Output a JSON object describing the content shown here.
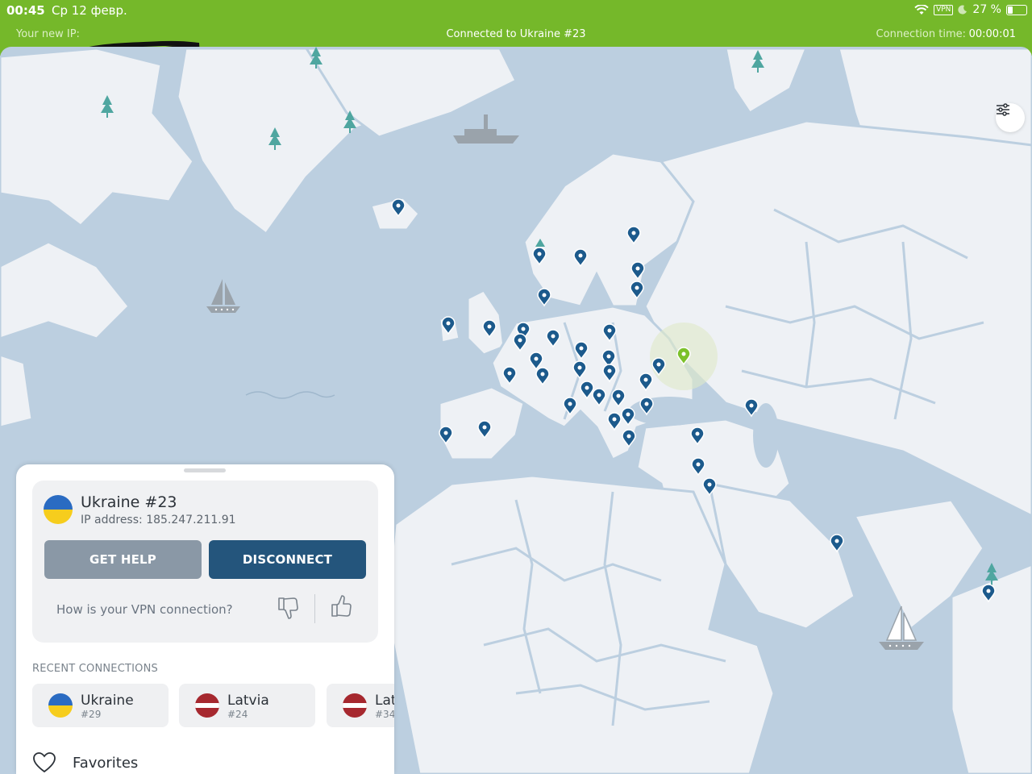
{
  "status_bar": {
    "time": "00:45",
    "date": "Ср 12 февр.",
    "vpn_badge": "VPN",
    "battery": "27 %",
    "battery_level": 0.27
  },
  "connection_bar": {
    "ip_label": "Your new IP:",
    "status": "Connected to Ukraine #23",
    "time_label": "Connection time:",
    "time": "00:00:01"
  },
  "map": {
    "active_marker_color": "#7cc12a",
    "marker_color": "#1c5a8c",
    "land_color": "#eef1f5",
    "water_color": "#bccfe0"
  },
  "panel": {
    "server": {
      "name": "Ukraine #23",
      "ip": "IP address: 185.247.211.91"
    },
    "buttons": {
      "help": "GET HELP",
      "disconnect": "DISCONNECT"
    },
    "feedback_question": "How is your VPN connection?",
    "recent_title": "RECENT CONNECTIONS",
    "recent": [
      {
        "country": "Ukraine",
        "number": "#29",
        "flag": "ukraine"
      },
      {
        "country": "Latvia",
        "number": "#24",
        "flag": "latvia"
      },
      {
        "country": "Latvia",
        "number": "#34",
        "flag": "latvia"
      }
    ],
    "favorites_label": "Favorites"
  }
}
